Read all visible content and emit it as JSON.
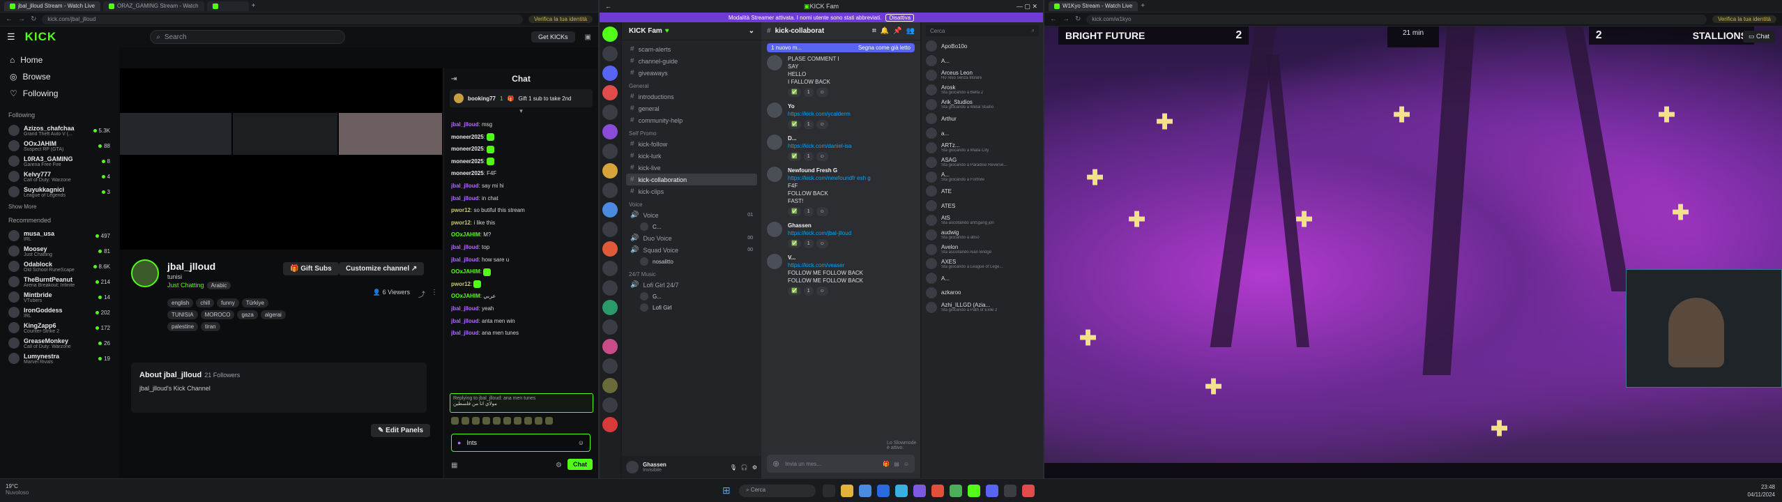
{
  "kick": {
    "tabs": [
      "jbal_jlloud Stream - Watch Live",
      "ORAZ_GAMING Stream - Watch",
      ""
    ],
    "url": "kick.com/jbal_jlloud",
    "verify": "Verifica la tua identità",
    "logo": "KICK",
    "search_placeholder": "Search",
    "get_kicks": "Get KICKs",
    "nav": [
      {
        "label": "Home",
        "icon": "home-icon"
      },
      {
        "label": "Browse",
        "icon": "compass-icon"
      },
      {
        "label": "Following",
        "icon": "heart-icon"
      }
    ],
    "following_header": "Following",
    "following": [
      {
        "name": "Azizos_chafchaa",
        "sub": "Grand Theft Auto V (...",
        "count": "5.3K"
      },
      {
        "name": "OOxJAHIM",
        "sub": "Suspect RP (GTA)",
        "count": "88"
      },
      {
        "name": "L0RA3_GAMING",
        "sub": "Garena Free Fire",
        "count": "8"
      },
      {
        "name": "Kelvy777",
        "sub": "Call of Duty: Warzone",
        "count": "4"
      },
      {
        "name": "Suyukkagnici",
        "sub": "League of Legends",
        "count": "3"
      }
    ],
    "show_more": "Show More",
    "recommended_header": "Recommended",
    "recommended": [
      {
        "name": "musa_usa",
        "sub": "IRL",
        "count": "497"
      },
      {
        "name": "Moosey",
        "sub": "Just Chatting",
        "count": "81"
      },
      {
        "name": "Odablock",
        "sub": "Old School RuneScape",
        "count": "8.6K"
      },
      {
        "name": "TheBurntPeanut",
        "sub": "Arena Breakout: Infinite",
        "count": "214"
      },
      {
        "name": "Mintbride",
        "sub": "VTubers",
        "count": "14"
      },
      {
        "name": "IronGoddess",
        "sub": "IRL",
        "count": "202"
      },
      {
        "name": "KingZapp6",
        "sub": "Counter-Strike 2",
        "count": "172"
      },
      {
        "name": "GreaseMonkey",
        "sub": "Call of Duty: Warzone",
        "count": "26"
      },
      {
        "name": "Lumynestra",
        "sub": "Marvel Rivals",
        "count": "19"
      }
    ],
    "channel": {
      "name": "jbal_jlloud",
      "title": "tunisi",
      "category": "Just Chatting",
      "language": "Arabic",
      "tags": [
        "english",
        "chill",
        "funny",
        "Türkiye",
        "TUNISIA",
        "MOROCO",
        "gaza",
        "algerai",
        "palestine",
        "tiran"
      ],
      "gift_subs": "Gift Subs",
      "customize": "Customize channel",
      "viewers": "6 Viewers"
    },
    "about_title": "About jbal_jlloud",
    "about_followers": "21 Followers",
    "about_desc": "jbal_jlloud's Kick Channel",
    "edit_panels": "Edit Panels",
    "chat_title": "Chat",
    "pinned": {
      "user": "booking77",
      "count": "1",
      "text": "Gift 1 sub to take 2nd"
    },
    "messages": [
      {
        "user": "jbal_jlloud",
        "text": "msg",
        "color": "#b06cff"
      },
      {
        "user": "moneer2025",
        "text": "",
        "color": "#e6e8ea"
      },
      {
        "user": "moneer2025",
        "text": "",
        "color": "#e6e8ea"
      },
      {
        "user": "moneer2025",
        "text": "",
        "color": "#e6e8ea"
      },
      {
        "user": "moneer2025",
        "text": "F4F",
        "color": "#e6e8ea"
      },
      {
        "user": "jbal_jlloud",
        "text": "say mi hi",
        "color": "#b06cff"
      },
      {
        "user": "jbal_jlloud",
        "text": "in chat",
        "color": "#b06cff"
      },
      {
        "user": "pwor12",
        "text": "so butiful this stream",
        "color": "#c8c870"
      },
      {
        "user": "pwor12",
        "text": "i like this",
        "color": "#c8c870"
      },
      {
        "user": "OOxJAHIM",
        "text": "M?",
        "color": "#53fc18"
      },
      {
        "user": "jbal_jlloud",
        "text": "top",
        "color": "#b06cff"
      },
      {
        "user": "jbal_jlloud",
        "text": "how sare u",
        "color": "#b06cff"
      },
      {
        "user": "OOxJAHIM",
        "text": "",
        "color": "#53fc18"
      },
      {
        "user": "pwor12",
        "text": "",
        "color": "#c8c870"
      },
      {
        "user": "OOxJAHIM",
        "text": "عربي",
        "color": "#53fc18"
      },
      {
        "user": "jbal_jlloud",
        "text": "yeah",
        "color": "#b06cff"
      },
      {
        "user": "jbal_jlloud",
        "text": "anta men win",
        "color": "#b06cff"
      },
      {
        "user": "jbal_jlloud",
        "text": "ana men tunes",
        "color": "#b06cff"
      }
    ],
    "reply_label": "Replying to jbal_jlloud: ana men tunes",
    "reply_text": "مولاي انا من فلسطين",
    "chat_input_value": "Ints",
    "chat_send": "Chat"
  },
  "discord": {
    "title": "KICK Fam",
    "banner": "Modalità Streamer attivata. I nomi utente sono stati abbreviati.",
    "banner_btn": "Disattiva",
    "server_name": "KICK Fam",
    "channels_top": [
      "scam-alerts",
      "channel-guide",
      "giveaways"
    ],
    "cat_general": "General",
    "channels_general": [
      "introductions",
      "general",
      "community-help"
    ],
    "cat_self": "Self Promo",
    "channels_self": [
      "kick-follow",
      "kick-lurk",
      "kick-live",
      "kick-collaboration",
      "kick-clips"
    ],
    "cat_voice": "Voice",
    "voice": [
      {
        "name": "Voice",
        "count": "01"
      },
      {
        "name": "Duo Voice",
        "count": "00"
      },
      {
        "name": "Squad Voice",
        "count": "00"
      }
    ],
    "voice_user": "C...",
    "voice_user2": "nosalitto",
    "cat_music": "24/7 Music",
    "music": [
      "Lofi Girl 24/7"
    ],
    "music_users": [
      "G...",
      "Lofi Girl"
    ],
    "user_bar": "Ghassen",
    "user_status": "Invisibile",
    "channel_header": "kick-collaborat",
    "new_msgs": "1 nuovo m...",
    "mark_read": "Segna come già letto",
    "dmessages": [
      {
        "author": "",
        "lines": [
          "PLASE COMMENT I",
          "SAY",
          "HELLO",
          "I FALLOW BACK"
        ],
        "link": ""
      },
      {
        "author": "Yo",
        "lines": [],
        "link": "https://kick.com/ycalderm"
      },
      {
        "author": "D...",
        "lines": [],
        "link": "https://kick.com/daniel-isa"
      },
      {
        "author": "Newfound Fresh G",
        "lines": [
          "F4F",
          "FOLLOW BACK",
          "FAST!"
        ],
        "link": "https://kick.com/newfoundfr esh g"
      },
      {
        "author": "Ghassen",
        "lines": [],
        "link": "https://kick.com/jbal-jlloud"
      },
      {
        "author": "V...",
        "lines": [
          "FOLLOW ME FOLLOW BACK",
          "FOLLOW ME FOLLOW BACK"
        ],
        "link": "https://kick.com/veaser"
      }
    ],
    "reply_hint": "Lo Slowmode è attivo.",
    "input_placeholder": "Invia un mes...",
    "members_search": "Cerca",
    "members": [
      {
        "name": "ApoBo10o",
        "act": ""
      },
      {
        "name": "A...",
        "act": ""
      },
      {
        "name": "Arceus Leon",
        "act": "Ho reso senza titolare"
      },
      {
        "name": "Arosk",
        "act": "Sta giocando a Bella 2"
      },
      {
        "name": "Arik_Studios",
        "act": "Sta giocando a Metal Studio"
      },
      {
        "name": "Arthur",
        "act": ""
      },
      {
        "name": "a...",
        "act": ""
      },
      {
        "name": "ARTz...",
        "act": "Sta giocando a Miata City"
      },
      {
        "name": "ASAG",
        "act": "Sta giocando a Paradise Reverse..."
      },
      {
        "name": "A...",
        "act": "Sta giocando a Fortnite"
      },
      {
        "name": "ATE",
        "act": ""
      },
      {
        "name": "ATES",
        "act": ""
      },
      {
        "name": "AtS",
        "act": "Sta ascoltando antsgang jon"
      },
      {
        "name": "audwig",
        "act": "Sta giocando a abso"
      },
      {
        "name": "Avelon",
        "act": "Sta ascoltando Alan Bridge"
      },
      {
        "name": "AXES",
        "act": "Sta giocando a League of Lege..."
      },
      {
        "name": "A...",
        "act": ""
      },
      {
        "name": "azkaroo",
        "act": ""
      },
      {
        "name": "Azhi_ILLGD (Azia...",
        "act": "Sta giocando a Path of Exile 2"
      }
    ]
  },
  "stream": {
    "tabs": [
      "W1Kyo Stream - Watch Live",
      "",
      ""
    ],
    "url": "kick.com/w1kyo",
    "verify": "Verifica la tua identità",
    "team_left": "BRIGHT FUTURE",
    "score_left": "2",
    "team_right": "STALLIONS",
    "score_right": "2",
    "timer": "21 min",
    "chat_btn": "Chat"
  },
  "taskbar": {
    "weather": "19°C",
    "weather_sub": "Nuvoloso",
    "search": "Cerca",
    "time": "23:48",
    "date": "04/11/2024"
  }
}
